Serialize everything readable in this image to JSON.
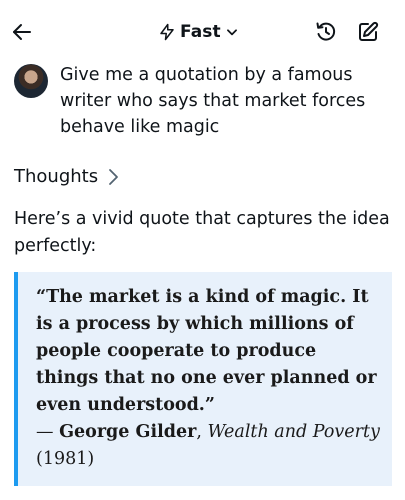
{
  "header": {
    "mode_label": "Fast",
    "icons": {
      "back": "arrow-left-icon",
      "mode": "lightning-icon",
      "chevron": "chevron-down-icon",
      "history": "history-icon",
      "compose": "compose-icon"
    }
  },
  "user_message": {
    "text": "Give me a quotation by a famous writer who says that market forces behave like magic"
  },
  "response": {
    "thoughts_label": "Thoughts",
    "intro": "Here’s a vivid quote that captures the idea perfectly:",
    "quote": {
      "text": "“The market is a kind of magic. It is a process by which millions of people cooperate to produce things that no one ever planned or even understood.”",
      "dash": "— ",
      "author": "George Gilder",
      "separator": ", ",
      "book": "Wealth and Poverty",
      "year": " (1981)"
    }
  },
  "colors": {
    "accent": "#1d9bf0",
    "quote_background": "#e8f1fb",
    "text": "#0f1419"
  }
}
